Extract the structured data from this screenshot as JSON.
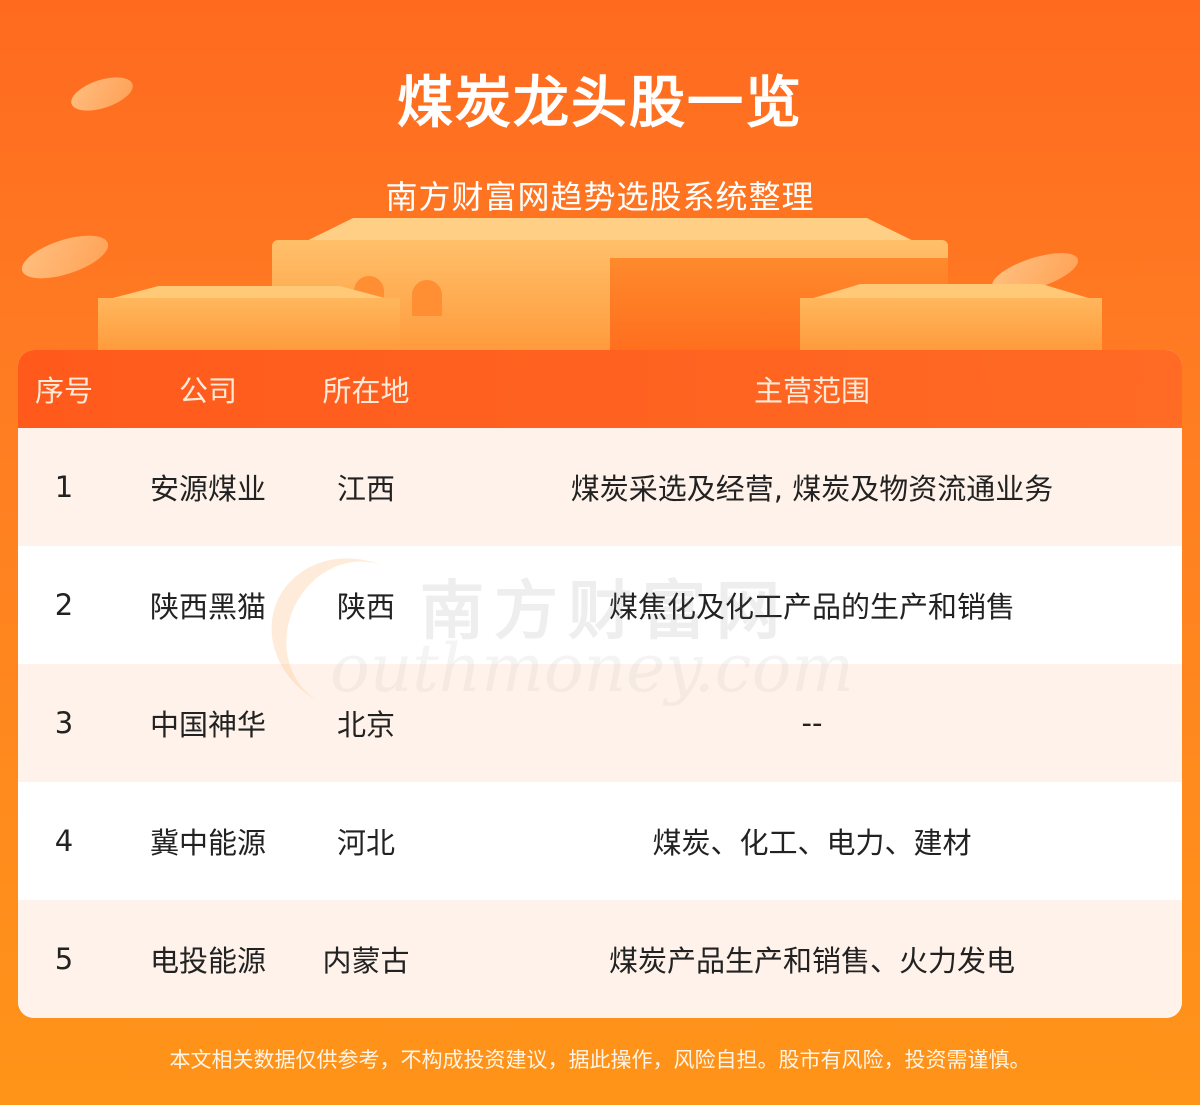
{
  "header": {
    "title": "煤炭龙头股一览",
    "subtitle": "南方财富网趋势选股系统整理"
  },
  "table": {
    "columns": [
      "序号",
      "公司",
      "所在地",
      "主营范围"
    ],
    "rows": [
      {
        "index": "1",
        "company": "安源煤业",
        "location": "江西",
        "scope": "煤炭采选及经营, 煤炭及物资流通业务"
      },
      {
        "index": "2",
        "company": "陕西黑猫",
        "location": "陕西",
        "scope": "煤焦化及化工产品的生产和销售"
      },
      {
        "index": "3",
        "company": "中国神华",
        "location": "北京",
        "scope": "--"
      },
      {
        "index": "4",
        "company": "冀中能源",
        "location": "河北",
        "scope": "煤炭、化工、电力、建材"
      },
      {
        "index": "5",
        "company": "电投能源",
        "location": "内蒙古",
        "scope": "煤炭产品生产和销售、火力发电"
      }
    ]
  },
  "watermark": {
    "cn": "南方财富网",
    "en": "outhmoney.com"
  },
  "footer": {
    "disclaimer": "本文相关数据仅供参考，不构成投资建议，据此操作，风险自担。股市有风险，投资需谨慎。"
  },
  "colors": {
    "background": "#ff7a22",
    "header_row": "#ff5a1c",
    "odd_row": "#fff2ea"
  }
}
